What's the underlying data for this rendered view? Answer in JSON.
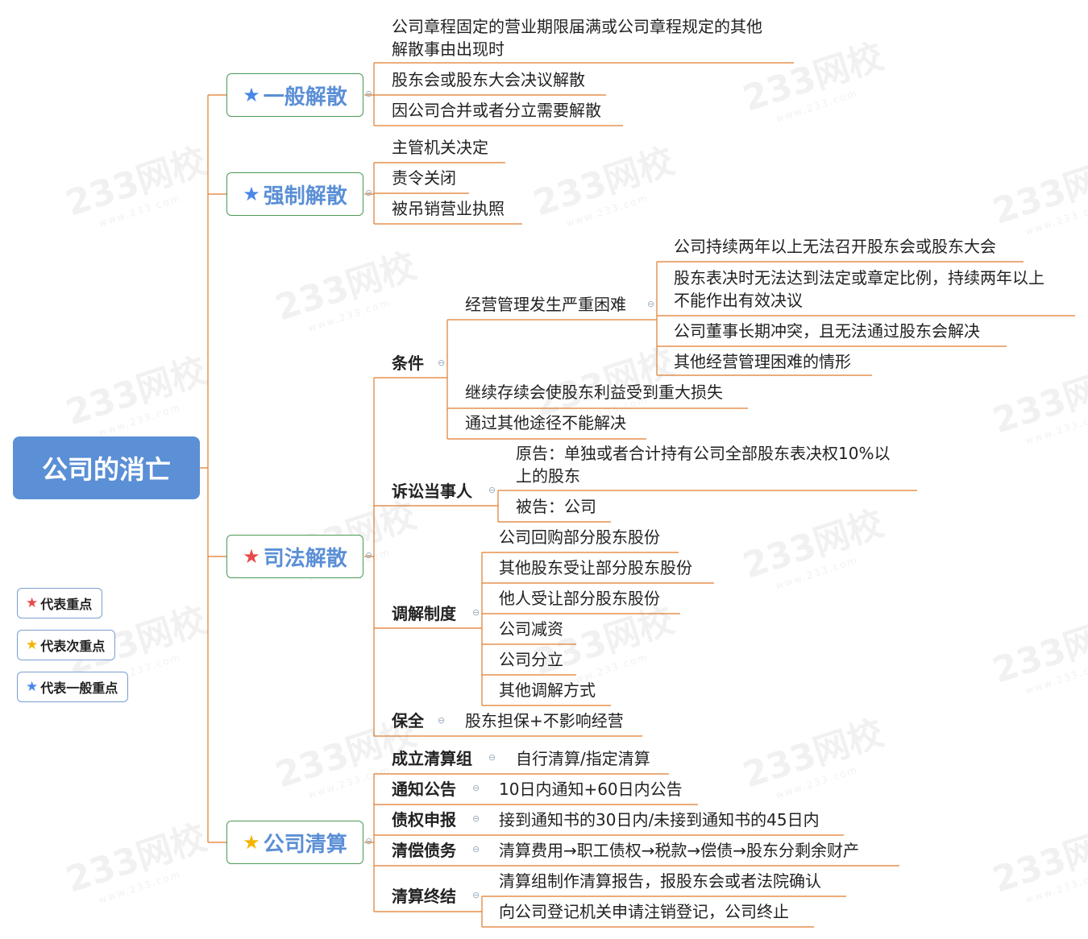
{
  "root": "公司的消亡",
  "colors": {
    "red": "#e84a4a",
    "yellow": "#f4b400",
    "blue": "#4a86e8",
    "line": "#e07b2a",
    "accent": "#5b8fd6"
  },
  "watermark": {
    "brand": "233网校",
    "url": "www.233.com"
  },
  "branches": [
    {
      "label": "一般解散",
      "star": "blue",
      "items": [
        "公司章程固定的营业期限届满或公司章程规定的其他",
        "解散事由出现时",
        "股东会或股东大会决议解散",
        "因公司合并或者分立需要解散"
      ]
    },
    {
      "label": "强制解散",
      "star": "blue",
      "items": [
        "主管机关决定",
        "责令关闭",
        "被吊销营业执照"
      ]
    },
    {
      "label": "司法解散",
      "star": "red",
      "tiaojian": {
        "label": "条件",
        "jingying": {
          "label": "经营管理发生严重困难",
          "items": [
            "公司持续两年以上无法召开股东会或股东大会",
            "股东表决时无法达到法定或章定比例，持续两年以上",
            "不能作出有效决议",
            "公司董事长期冲突，且无法通过股东会解决",
            "其他经营管理困难的情形"
          ]
        },
        "others": [
          "继续存续会使股东利益受到重大损失",
          "通过其他途径不能解决"
        ]
      },
      "susong": {
        "label": "诉讼当事人",
        "items": [
          "原告：单独或者合计持有公司全部股东表决权10%以",
          "上的股东",
          "被告：公司"
        ]
      },
      "tiaojie": {
        "label": "调解制度",
        "items": [
          "公司回购部分股东股份",
          "其他股东受让部分股东股份",
          "他人受让部分股东股份",
          "公司减资",
          "公司分立",
          "其他调解方式"
        ]
      },
      "baoquan": {
        "label": "保全",
        "item": "股东担保+不影响经营"
      }
    },
    {
      "label": "公司清算",
      "star": "yellow",
      "steps": [
        {
          "label": "成立清算组",
          "items": [
            "自行清算/指定清算"
          ]
        },
        {
          "label": "通知公告",
          "items": [
            "10日内通知+60日内公告"
          ]
        },
        {
          "label": "债权申报",
          "items": [
            "接到通知书的30日内/未接到通知书的45日内"
          ]
        },
        {
          "label": "清偿债务",
          "items": [
            "清算费用→职工债权→税款→偿债→股东分剩余财产"
          ]
        },
        {
          "label": "清算终结",
          "items": [
            "清算组制作清算报告，报股东会或者法院确认",
            "向公司登记机关申请注销登记，公司终止"
          ]
        }
      ]
    }
  ],
  "legend": [
    {
      "star": "red",
      "label": "代表重点"
    },
    {
      "star": "yellow",
      "label": "代表次重点"
    },
    {
      "star": "blue",
      "label": "代表一般重点"
    }
  ]
}
